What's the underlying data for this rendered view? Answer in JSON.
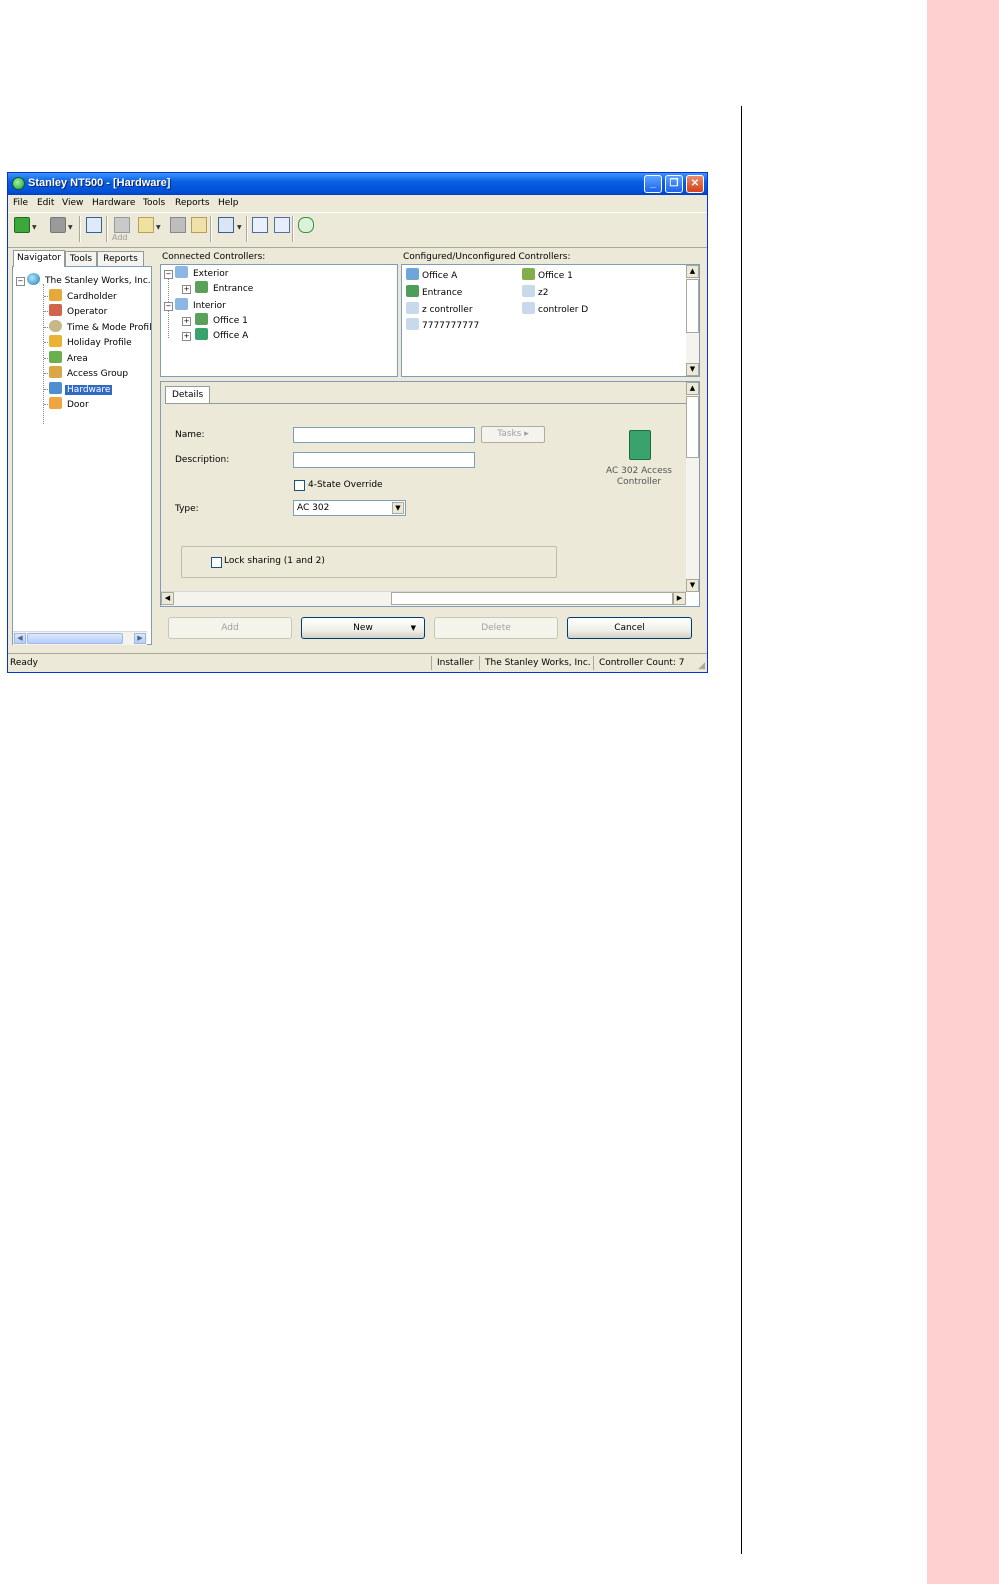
{
  "window": {
    "title": "Stanley NT500 - [Hardware]"
  },
  "menu": [
    "File",
    "Edit",
    "View",
    "Hardware",
    "Tools",
    "Reports",
    "Help"
  ],
  "toolbar": {
    "add_label": "Add"
  },
  "navigator": {
    "tabs": [
      "Navigator",
      "Tools",
      "Reports"
    ],
    "root": "The Stanley Works, Inc.",
    "items": [
      "Cardholder",
      "Operator",
      "Time & Mode Profile",
      "Holiday Profile",
      "Area",
      "Access Group",
      "Hardware",
      "Door"
    ],
    "selected": "Hardware"
  },
  "connected": {
    "label": "Connected Controllers:",
    "groups": [
      {
        "name": "Exterior",
        "children": [
          "Entrance"
        ]
      },
      {
        "name": "Interior",
        "children": [
          "Office 1",
          "Office A"
        ]
      }
    ]
  },
  "configured": {
    "label": "Configured/Unconfigured Controllers:",
    "items": [
      "Office A",
      "Office 1",
      "Entrance",
      "z2",
      "z controller",
      "controler D",
      "7777777777"
    ]
  },
  "details": {
    "tab": "Details",
    "name_label": "Name:",
    "name_value": "",
    "description_label": "Description:",
    "description_value": "",
    "tasks_label": "Tasks",
    "override_label": "4-State Override",
    "type_label": "Type:",
    "type_value": "AC 302",
    "lock_sharing_label": "Lock sharing (1 and 2)",
    "controller_caption": "AC 302 Access Controller"
  },
  "buttons": {
    "add": "Add",
    "new": "New",
    "delete": "Delete",
    "cancel": "Cancel"
  },
  "status": {
    "ready": "Ready",
    "user": "Installer",
    "company": "The Stanley Works, Inc.",
    "count": "Controller Count: 7"
  },
  "colors": {
    "titlebar": "#0a5fe0",
    "selection": "#316ac5",
    "side_band": "#ffd0d0"
  }
}
